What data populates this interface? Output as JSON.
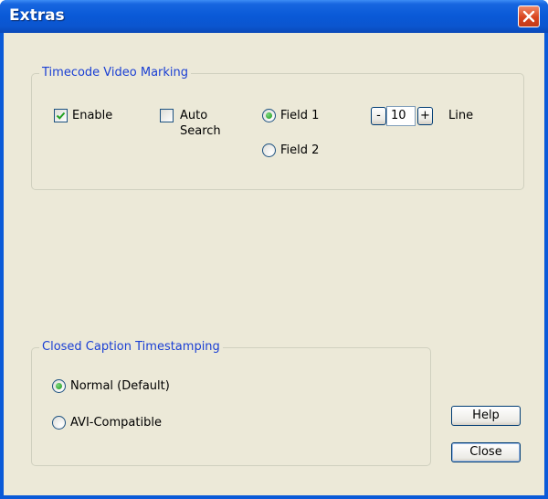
{
  "window": {
    "title": "Extras"
  },
  "timecode": {
    "legend": "Timecode Video Marking",
    "enable_label": "Enable",
    "enable_checked": true,
    "auto_search_label": "Auto\nSearch",
    "auto_search_checked": false,
    "field1_label": "Field 1",
    "field2_label": "Field 2",
    "selected_field": "Field 1",
    "decrement_label": "-",
    "line_value": "10",
    "increment_label": "+",
    "line_label": "Line"
  },
  "closed_caption": {
    "legend": "Closed Caption Timestamping",
    "normal_label": "Normal (Default)",
    "avi_label": "AVI-Compatible",
    "selected": "Normal (Default)"
  },
  "buttons": {
    "help": "Help",
    "close": "Close"
  },
  "icons": {
    "close": "close-icon",
    "check": "checkmark-icon"
  },
  "colors": {
    "title_bar": "#0a5ad8",
    "client_bg": "#ece9d8",
    "legend_text": "#1a3fd4",
    "close_button": "#d8451f"
  }
}
